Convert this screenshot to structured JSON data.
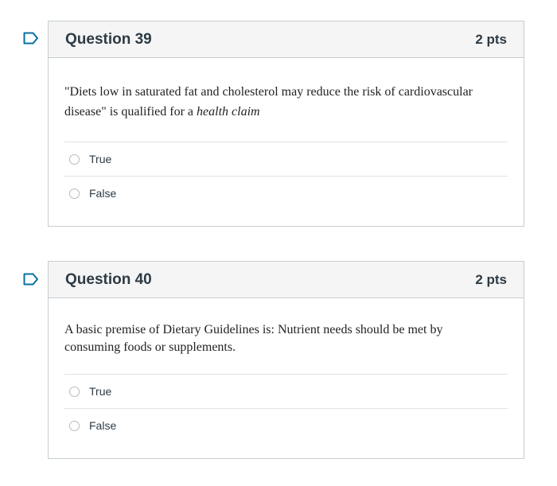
{
  "colors": {
    "accent": "#0770a3",
    "border": "#c7cdd1",
    "header_bg": "#f5f5f5"
  },
  "questions": [
    {
      "flag_icon": "bookmark-flag-icon",
      "title": "Question 39",
      "points": "2 pts",
      "text_before": "\"Diets low in saturated fat and cholesterol may reduce the risk of cardiovascular disease\" is qualified for a ",
      "text_emphasis": "health claim",
      "answers": [
        "True",
        "False"
      ]
    },
    {
      "flag_icon": "bookmark-flag-icon",
      "title": "Question 40",
      "points": "2 pts",
      "text_before": "A basic premise of Dietary Guidelines is: Nutrient needs should be met by consuming foods or supplements.",
      "text_emphasis": "",
      "answers": [
        "True",
        "False"
      ]
    }
  ]
}
